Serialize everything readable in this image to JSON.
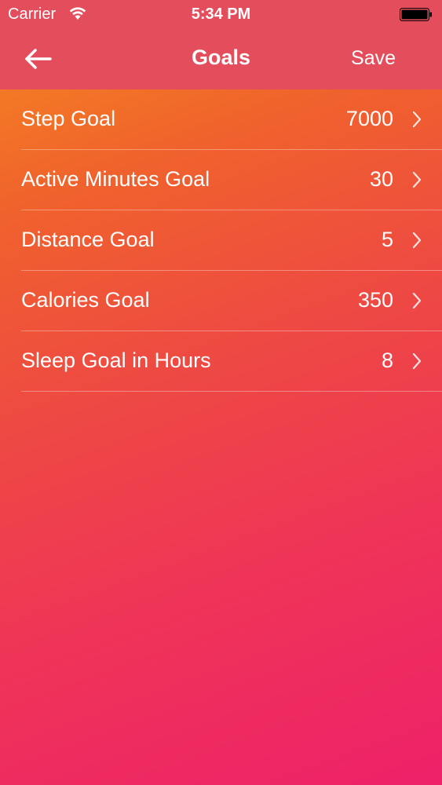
{
  "status_bar": {
    "carrier": "Carrier",
    "time": "5:34 PM"
  },
  "nav": {
    "back_icon": "arrow-left-icon",
    "title": "Goals",
    "save_label": "Save"
  },
  "goals": [
    {
      "label": "Step Goal",
      "value": "7000"
    },
    {
      "label": "Active Minutes Goal",
      "value": "30"
    },
    {
      "label": "Distance Goal",
      "value": "5"
    },
    {
      "label": "Calories Goal",
      "value": "350"
    },
    {
      "label": "Sleep Goal in Hours",
      "value": "8"
    }
  ],
  "colors": {
    "header": "#e34d5c",
    "gradient_top": "#f68a1f",
    "gradient_bottom": "#ee2169"
  }
}
